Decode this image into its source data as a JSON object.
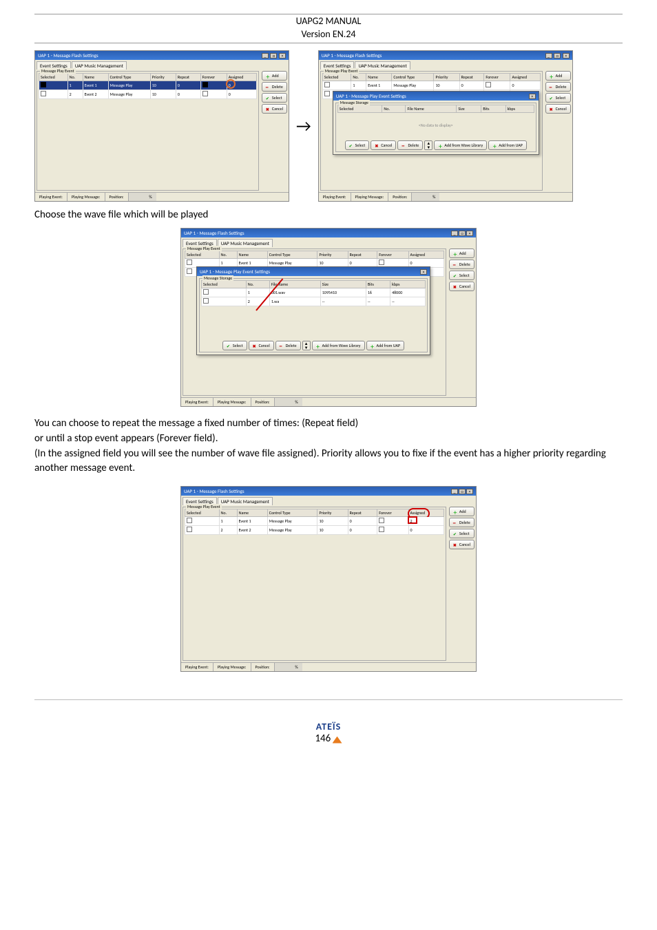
{
  "header": {
    "title": "UAPG2 MANUAL",
    "version": "Version EN.24"
  },
  "caption_choose": "Choose the wave file which will be played",
  "para1": "You can choose to repeat the message a fixed number of times: (Repeat field)",
  "para2": " or until a stop event appears (Forever field).",
  "para3": "(In the assigned field you will see the number of wave file assigned). Priority allows you to fixe if the event has a higher priority regarding another message event.",
  "win_common": {
    "title": "UAP 1 - Message Flash Settings",
    "tab1": "Event Settings",
    "tab2": "UAP Music Management",
    "group": "Message Play Event",
    "cols": {
      "sel": "Selected",
      "no": "No.",
      "name": "Name",
      "ctype": "Control Type",
      "prio": "Priority",
      "rep": "Repeat",
      "forever": "Forever",
      "assigned": "Assigned"
    },
    "add": "Add",
    "delete": "Delete",
    "select": "Select",
    "cancel": "Cancel",
    "status": {
      "pe": "Playing Event:",
      "pm": "Playing Message:",
      "pos": "Position:",
      "pct": "%"
    }
  },
  "win1_rows": [
    {
      "no": "1",
      "name": "Event 1",
      "ctype": "Message Play",
      "prio": "10",
      "rep": "0",
      "forever": "solid",
      "assigned": "0",
      "sel": "solid"
    },
    {
      "no": "2",
      "name": "Event 2",
      "ctype": "Message Play",
      "prio": "10",
      "rep": "0",
      "forever": "",
      "assigned": "0",
      "sel": ""
    }
  ],
  "win2_rows": [
    {
      "no": "1",
      "name": "Event 1",
      "ctype": "Message Play",
      "prio": "10",
      "rep": "0",
      "forever": "",
      "assigned": "0"
    },
    {
      "no": "2",
      "name": "Event 2",
      "ctype": "Message Play",
      "prio": "10",
      "rep": "0",
      "forever": "",
      "assigned": "0"
    }
  ],
  "inner_dialog": {
    "title": "UAP 1 - Message Play Event Settings",
    "group": "Message Storage",
    "cols": {
      "sel": "Selected",
      "no": "No.",
      "file": "File Name",
      "size": "Size",
      "bits": "Bits",
      "kbps": "kbps"
    },
    "empty": "<No data to display>",
    "btns": {
      "select": "Select",
      "cancel": "Cancel",
      "delete": "Delete",
      "addlib": "Add from Wave Library",
      "adduap": "Add from UAP"
    }
  },
  "win3": {
    "rows": [
      {
        "no": "1",
        "name": "Event 1",
        "ctype": "Message Play",
        "prio": "10",
        "rep": "0",
        "assigned": "0"
      },
      {
        "no": "2",
        "name": "Event 2",
        "ctype": "Message Play",
        "prio": "10",
        "rep": "0",
        "assigned": "0"
      }
    ],
    "inner_rows": [
      {
        "no": "1",
        "file": "001.wav",
        "size": "1095410",
        "bits": "16",
        "kbps": "48000"
      },
      {
        "no": "2",
        "file": "1.wa",
        "size": "--",
        "bits": "--",
        "kbps": "--"
      }
    ]
  },
  "win4_rows": [
    {
      "no": "1",
      "name": "Event 1",
      "ctype": "Message Play",
      "prio": "10",
      "rep": "0",
      "forever": "",
      "assigned": "2"
    },
    {
      "no": "2",
      "name": "Event 2",
      "ctype": "Message Play",
      "prio": "10",
      "rep": "0",
      "forever": "",
      "assigned": "0"
    }
  ],
  "footer": {
    "brand": "ATEÏS",
    "page": "146"
  }
}
